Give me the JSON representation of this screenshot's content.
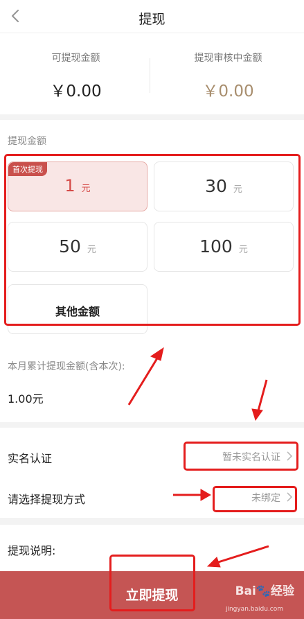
{
  "header": {
    "title": "提现",
    "back_icon": "chevron-left-icon"
  },
  "balance": {
    "available_label": "可提现金额",
    "available_value": "￥0.00",
    "pending_label": "提现审核中金额",
    "pending_value": "￥0.00",
    "pending_color": "#a88e6e"
  },
  "amount": {
    "section_label": "提现金额",
    "options": [
      {
        "value": "1",
        "unit": "元",
        "tag": "首次提现",
        "selected": true
      },
      {
        "value": "30",
        "unit": "元"
      },
      {
        "value": "50",
        "unit": "元"
      },
      {
        "value": "100",
        "unit": "元"
      }
    ],
    "other_label": "其他金额",
    "cumulative_label": "本月累计提现金额(含本次):",
    "cumulative_value": "1.00元"
  },
  "rows": {
    "realname_label": "实名认证",
    "realname_value": "暂未实名认证",
    "method_label": "请选择提现方式",
    "method_value": "未绑定"
  },
  "description": {
    "label": "提现说明:"
  },
  "submit": {
    "label": "立即提现"
  },
  "watermark": {
    "text": "Bai🐾经验",
    "url": "jingyan.baidu.com"
  },
  "colors": {
    "accent": "#c55554",
    "highlight": "#e41d1d",
    "selected_bg": "#f9e6e5"
  }
}
